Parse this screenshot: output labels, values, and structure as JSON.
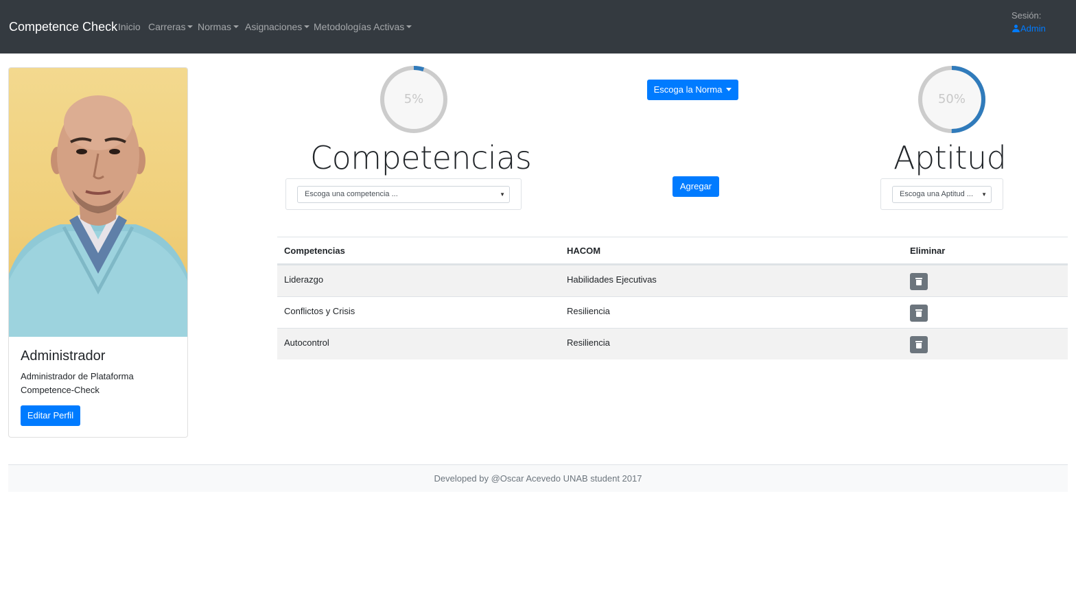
{
  "navbar": {
    "brand": "Competence Check",
    "items": [
      {
        "label": "Inicio",
        "dropdown": false
      },
      {
        "label": "Carreras",
        "dropdown": true
      },
      {
        "label": "Normas",
        "dropdown": true
      },
      {
        "label": "Asignaciones",
        "dropdown": true
      },
      {
        "label": "Metodologías Activas",
        "dropdown": true
      }
    ],
    "session_label": "Sesión:",
    "session_user": "Admin",
    "user_icon": "user-icon"
  },
  "profile": {
    "photo": "profile-photo",
    "title": "Administrador",
    "description": "Administrador de Plataforma Competence-Check",
    "edit_button": "Editar Perfil"
  },
  "competencias": {
    "progress_label": "5%",
    "progress_value": 0.05,
    "title": "Competencias",
    "select_placeholder": "Escoga una competencia ..."
  },
  "norma_button": "Escoga la Norma",
  "add_button": "Agregar",
  "aptitud": {
    "progress_label": "50%",
    "progress_value": 0.5,
    "title": "Aptitud",
    "select_placeholder": "Escoga una Aptitud ..."
  },
  "table": {
    "headers": [
      "Competencias",
      "HACOM",
      "Eliminar"
    ],
    "rows": [
      {
        "competencia": "Liderazgo",
        "hacom": "Habilidades Ejecutivas"
      },
      {
        "competencia": "Conflictos y Crisis",
        "hacom": "Resiliencia"
      },
      {
        "competencia": "Autocontrol",
        "hacom": "Resiliencia"
      }
    ],
    "delete_icon": "trash-icon"
  },
  "footer": {
    "text": "Developed by @Oscar Acevedo UNAB student 2017"
  },
  "colors": {
    "navbar_bg": "#343a40",
    "primary": "#007bff",
    "ring_track": "#cccccc",
    "ring_fill": "#307bbb",
    "delete_button": "#6c757d"
  }
}
